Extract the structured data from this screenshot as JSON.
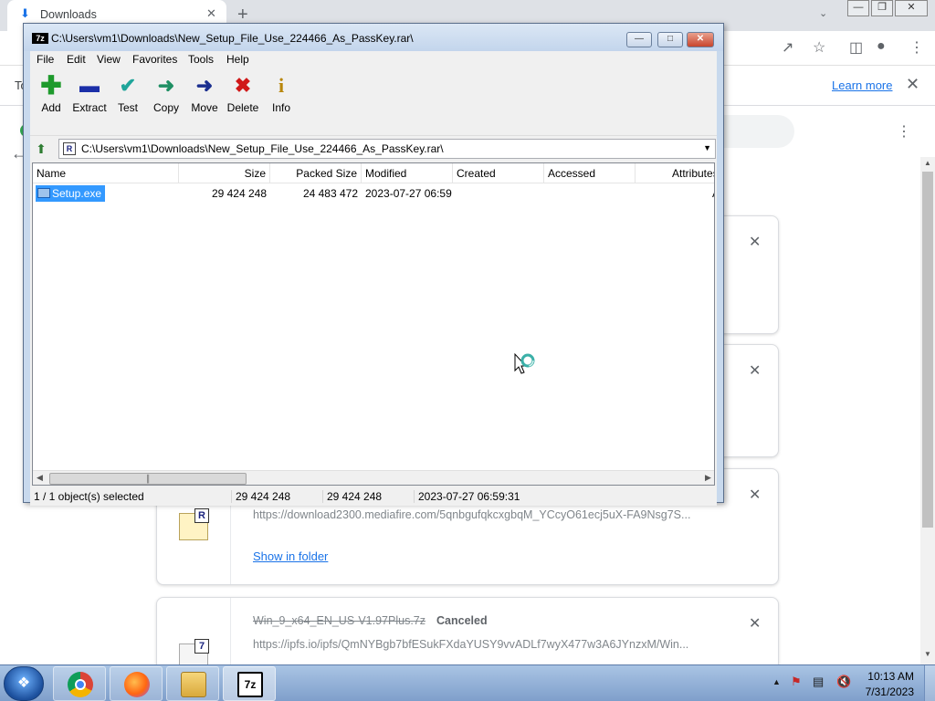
{
  "browser": {
    "tab_title": "Downloads",
    "infobar_text": "To",
    "infobar_link": "Learn more",
    "downloads": [
      {
        "url": "https://download2300.mediafire.com/5qnbgufqkcxgbqM_YCcyO61ecj5uX-FA9Nsg7S...",
        "action": "Show in folder",
        "icon_badge": "R"
      },
      {
        "name": "Win_9_x64_EN_US-V1.97Plus.7z",
        "status": "Canceled",
        "url": "https://ipfs.io/ipfs/QmNYBgb7bfESukFXdaYUSY9vvADLf7wyX477w3A6JYnzxM/Win...",
        "icon_badge": "7"
      }
    ]
  },
  "sevenzip": {
    "app_icon": "7z",
    "title": "C:\\Users\\vm1\\Downloads\\New_Setup_File_Use_224466_As_PassKey.rar\\",
    "menu": [
      "File",
      "Edit",
      "View",
      "Favorites",
      "Tools",
      "Help"
    ],
    "toolbar": [
      {
        "label": "Add",
        "icon": "plus-icon",
        "color": "#1e9a2c"
      },
      {
        "label": "Extract",
        "icon": "minus-icon",
        "color": "#1b2fa8"
      },
      {
        "label": "Test",
        "icon": "check-icon",
        "color": "#1fa59a"
      },
      {
        "label": "Copy",
        "icon": "arrow-right-icon",
        "color": "#1f8f63"
      },
      {
        "label": "Move",
        "icon": "arrow-right-icon",
        "color": "#1b2f8f"
      },
      {
        "label": "Delete",
        "icon": "x-icon",
        "color": "#d01818"
      },
      {
        "label": "Info",
        "icon": "info-icon",
        "color": "#b8860b"
      }
    ],
    "address": "C:\\Users\\vm1\\Downloads\\New_Setup_File_Use_224466_As_PassKey.rar\\",
    "address_icon": "R",
    "columns": [
      "Name",
      "Size",
      "Packed Size",
      "Modified",
      "Created",
      "Accessed",
      "Attributes"
    ],
    "rows": [
      {
        "name": "Setup.exe",
        "size": "29 424 248",
        "packed": "24 483 472",
        "modified": "2023-07-27 06:59",
        "attr": "A"
      }
    ],
    "status": {
      "selected": "1 / 1 object(s) selected",
      "size": "29 424 248",
      "packed": "29 424 248",
      "modified": "2023-07-27 06:59:31"
    }
  },
  "taskbar": {
    "time": "10:13 AM",
    "date": "7/31/2023",
    "sevenzip_label": "7z"
  }
}
